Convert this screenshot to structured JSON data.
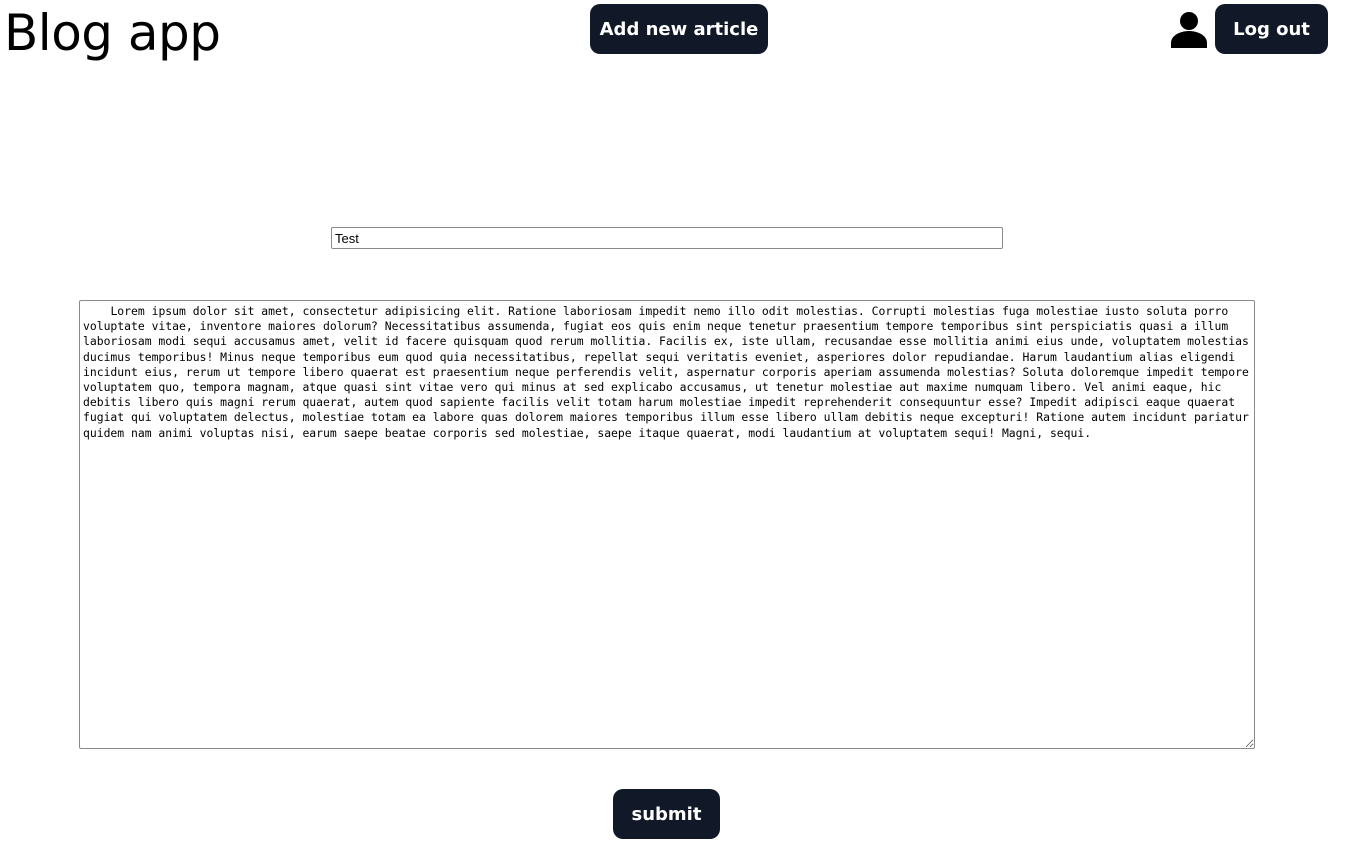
{
  "header": {
    "app_title": "Blog app",
    "add_article_label": "Add new article",
    "logout_label": "Log out",
    "user_icon": "user-icon"
  },
  "form": {
    "title_value": "Test",
    "body_value": "    Lorem ipsum dolor sit amet, consectetur adipisicing elit. Ratione laboriosam impedit nemo illo odit molestias. Corrupti molestias fuga molestiae iusto soluta porro voluptate vitae, inventore maiores dolorum? Necessitatibus assumenda, fugiat eos quis enim neque tenetur praesentium tempore temporibus sint perspiciatis quasi a illum laboriosam modi sequi accusamus amet, velit id facere quisquam quod rerum mollitia. Facilis ex, iste ullam, recusandae esse mollitia animi eius unde, voluptatem molestias ducimus temporibus! Minus neque temporibus eum quod quia necessitatibus, repellat sequi veritatis eveniet, asperiores dolor repudiandae. Harum laudantium alias eligendi incidunt eius, rerum ut tempore libero quaerat est praesentium neque perferendis velit, aspernatur corporis aperiam assumenda molestias? Soluta doloremque impedit tempore voluptatem quo, tempora magnam, atque quasi sint vitae vero qui minus at sed explicabo accusamus, ut tenetur molestiae aut maxime numquam libero. Vel animi eaque, hic debitis libero quis magni rerum quaerat, autem quod sapiente facilis velit totam harum molestiae impedit reprehenderit consequuntur esse? Impedit adipisci eaque quaerat fugiat qui voluptatem delectus, molestiae totam ea labore quas dolorem maiores temporibus illum esse libero ullam debitis neque excepturi! Ratione autem incidunt pariatur quidem nam animi voluptas nisi, earum saepe beatae corporis sed molestiae, saepe itaque quaerat, modi laudantium at voluptatem sequi! Magni, sequi.",
    "submit_label": "submit"
  }
}
